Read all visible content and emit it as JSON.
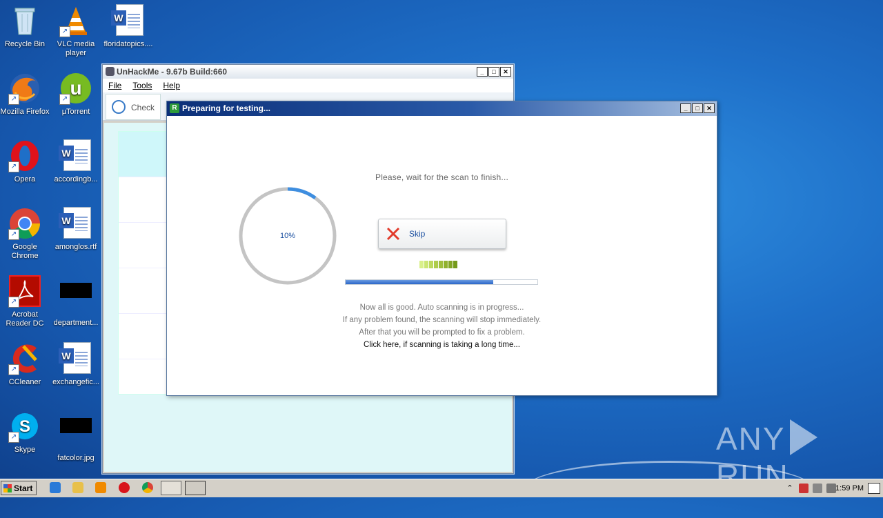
{
  "desktop": {
    "icons": [
      {
        "label": "Recycle Bin"
      },
      {
        "label": "VLC media player"
      },
      {
        "label": "floridatopics...."
      },
      {
        "label": "Mozilla Firefox"
      },
      {
        "label": "µTorrent"
      },
      {
        "label": "Opera"
      },
      {
        "label": "accordingb..."
      },
      {
        "label": "Google Chrome"
      },
      {
        "label": "amonglos.rtf"
      },
      {
        "label": "Acrobat Reader DC"
      },
      {
        "label": "department..."
      },
      {
        "label": "CCleaner"
      },
      {
        "label": "exchangefic..."
      },
      {
        "label": "Skype"
      },
      {
        "label": "fatcolor.jpg"
      }
    ]
  },
  "unhackme": {
    "title": "UnHackMe - 9.67b Build:660",
    "menu": [
      "File",
      "Tools",
      "Help"
    ],
    "toolbar": {
      "check_label": "Check"
    }
  },
  "dialog": {
    "title": "Preparing for testing...",
    "wait_message": "Please, wait for the scan to finish...",
    "progress_percent": 10,
    "progress_label": "10%",
    "skip_label": "Skip",
    "progress_bar_fraction": 0.77,
    "lines": [
      "Now all is good. Auto scanning is in progress...",
      "If any problem found, the scanning will stop immediately.",
      "After that you will be prompted to fix a problem."
    ],
    "long_time_link": "Click here, if scanning is taking a long time...",
    "activity_colors": [
      "#d9f08a",
      "#cbe673",
      "#bdd95e",
      "#aecc4c",
      "#9fbe3c",
      "#90b12e",
      "#82a524",
      "#759a1c"
    ]
  },
  "taskbar": {
    "start_label": "Start",
    "clock": "1:59 PM"
  },
  "watermark": {
    "left": "ANY",
    "right": "RUN"
  }
}
